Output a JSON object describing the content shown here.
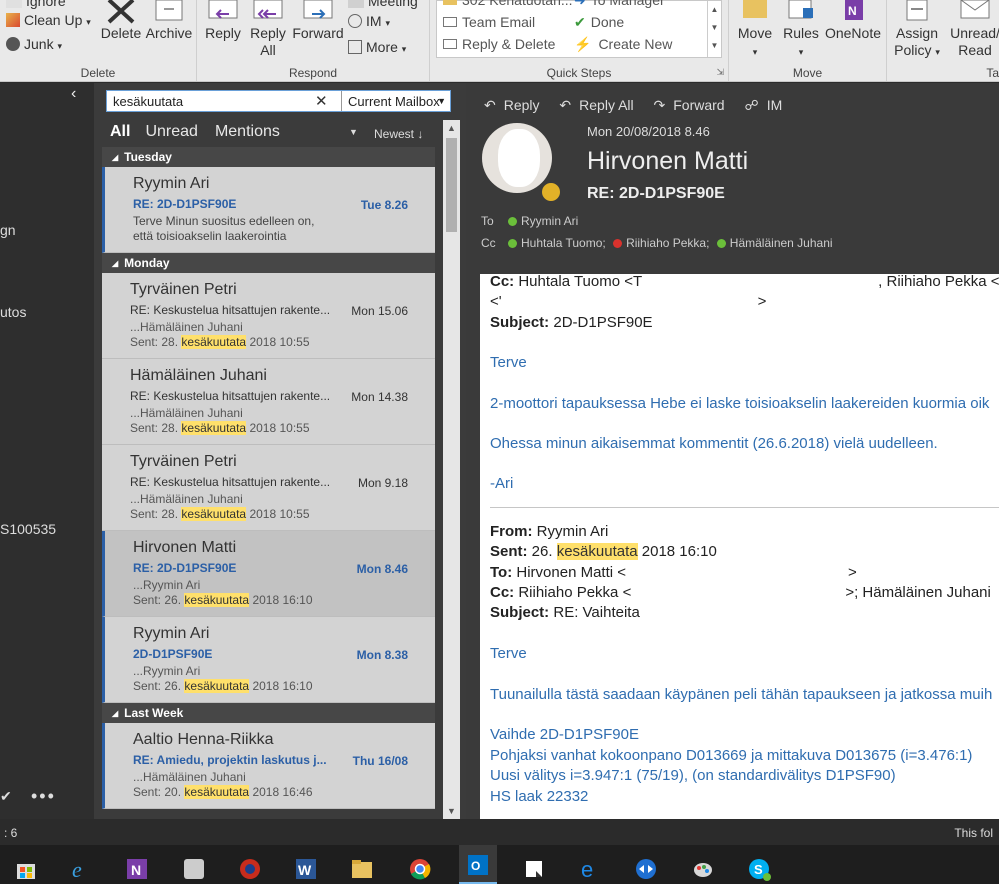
{
  "ribbon": {
    "delete_group": {
      "label": "Delete",
      "ignore": "Ignore",
      "clean_up": "Clean Up",
      "junk": "Junk",
      "delete": "Delete",
      "archive": "Archive"
    },
    "respond_group": {
      "label": "Respond",
      "reply": "Reply",
      "reply_all_1": "Reply",
      "reply_all_2": "All",
      "forward": "Forward",
      "meeting": "Meeting",
      "im": "IM",
      "more": "More"
    },
    "quick_steps": {
      "label": "Quick Steps",
      "items": [
        "302 Kehätuotan...",
        "To Manager",
        "Team Email",
        "Done",
        "Reply & Delete",
        "Create New"
      ]
    },
    "move_group": {
      "label": "Move",
      "move": "Move",
      "rules": "Rules",
      "onenote": "OneNote"
    },
    "tags_group": {
      "assign_policy_1": "Assign",
      "assign_policy_2": "Policy",
      "unread_1": "Unread/",
      "unread_2": "Read",
      "label": "Ta"
    }
  },
  "folder_pane": {
    "items": [
      "gn",
      "utos",
      "S100535"
    ]
  },
  "search": {
    "query": "kesäkuutata",
    "scope": "Current Mailbox"
  },
  "filters": {
    "all": "All",
    "unread": "Unread",
    "mentions": "Mentions",
    "sort": "Newest"
  },
  "groups": {
    "tuesday": "Tuesday",
    "monday": "Monday",
    "last_week": "Last Week"
  },
  "messages": [
    {
      "from": "Ryymin Ari",
      "subject": "RE: 2D-D1PSF90E",
      "date": "Tue 8.26",
      "preview": "Terve  Minun suositus edelleen on, että toisioakselin laakerointia"
    },
    {
      "from": "Tyrväinen Petri",
      "subject": "RE: Keskustelua hitsattujen rakente...",
      "date": "Mon 15.06",
      "pv1": "...Hämäläinen Juhani",
      "sent_pre": "Sent: 28.",
      "hl": "kesäkuutata",
      "sent_post": "2018 10:55"
    },
    {
      "from": "Hämäläinen Juhani",
      "subject": "RE: Keskustelua hitsattujen rakente...",
      "date": "Mon 14.38",
      "pv1": "...Hämäläinen Juhani",
      "sent_pre": "Sent: 28.",
      "hl": "kesäkuutata",
      "sent_post": "2018 10:55"
    },
    {
      "from": "Tyrväinen Petri",
      "subject": "RE: Keskustelua hitsattujen rakente...",
      "date": "Mon 9.18",
      "pv1": "...Hämäläinen Juhani",
      "sent_pre": "Sent: 28.",
      "hl": "kesäkuutata",
      "sent_post": "2018 10:55"
    },
    {
      "from": "Hirvonen Matti",
      "subject": "RE: 2D-D1PSF90E",
      "date": "Mon 8.46",
      "pv1": "...Ryymin Ari",
      "sent_pre": "Sent: 26.",
      "hl": "kesäkuutata",
      "sent_post": "2018 16:10"
    },
    {
      "from": "Ryymin Ari",
      "subject": "2D-D1PSF90E",
      "date": "Mon 8.38",
      "pv1": "...Ryymin Ari",
      "sent_pre": "Sent: 26.",
      "hl": "kesäkuutata",
      "sent_post": "2018 16:10"
    },
    {
      "from": "Aaltio Henna-Riikka",
      "subject": "RE: Amiedu, projektin laskutus j...",
      "date": "Thu 16/08",
      "pv1": "...Hämäläinen Juhani",
      "sent_pre": "Sent: 20.",
      "hl": "kesäkuutata",
      "sent_post": "2018 16:46"
    }
  ],
  "reading": {
    "actions": {
      "reply": "Reply",
      "reply_all": "Reply All",
      "forward": "Forward",
      "im": "IM"
    },
    "date": "Mon 20/08/2018 8.46",
    "sender": "Hirvonen Matti",
    "subject": "RE: 2D-D1PSF90E",
    "to_label": "To",
    "to": "Ryymin Ari",
    "cc_label": "Cc",
    "cc": [
      {
        "name": "Huhtala Tuomo;",
        "status": "g"
      },
      {
        "name": "Riihiaho Pekka;",
        "status": "r"
      },
      {
        "name": "Hämäläinen Juhani",
        "status": "g"
      }
    ],
    "body": {
      "cc_label": "Cc:",
      "cc_text1": "Huhtala Tuomo <T",
      "cc_text2": ", Riihiaho Pekka <",
      "cc_text3": "<'",
      "cc_text4": ">",
      "subject_label": "Subject:",
      "subject": "2D-D1PSF90E",
      "greeting": "Terve",
      "line1": "2-moottori tapauksessa Hebe ei laske toisioakselin laakereiden kuormia oik",
      "line2": "Ohessa minun aikaisemmat kommentit (26.6.2018) vielä uudelleen.",
      "sig": "-Ari",
      "from_label": "From:",
      "from": "Ryymin Ari",
      "sent_label": "Sent:",
      "sent_pre": "26.",
      "sent_hl": "kesäkuutata",
      "sent_post": "2018 16:10",
      "to_label": "To:",
      "to": "Hirvonen Matti <",
      "to_end": ">",
      "cc2_label": "Cc:",
      "cc2": "Riihiaho Pekka <",
      "cc2_end": ">; Hämäläinen Juhani",
      "subject2_label": "Subject:",
      "subject2": "RE: Vaihteita",
      "greeting2": "Terve",
      "line3": "Tuunailulla tästä saadaan käypänen peli tähän tapaukseen ja jatkossa muih",
      "line4": "Vaihde 2D-D1PSF90E",
      "line5": "Pohjaksi vanhat kokoonpano D013669 ja mittakuva D013675 (i=3.476:1)",
      "line6": "Uusi välitys i=3.947:1 (75/19), (on standardivälitys D1PSF90)",
      "line7": "HS laak 22332"
    }
  },
  "status": {
    "left": ": 6",
    "right": "This fol"
  },
  "colors": {
    "accent": "#2b5fa6",
    "highlight": "#ffe06b",
    "presence_green": "#6bbf3a",
    "presence_red": "#d9322d"
  }
}
